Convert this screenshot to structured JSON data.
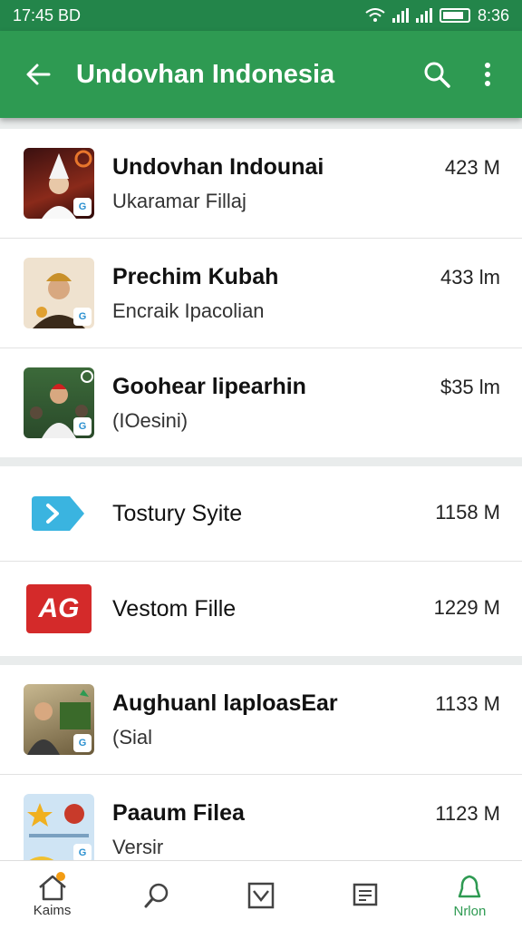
{
  "status_bar": {
    "time_left": "17:45 BD",
    "time_right": "8:36"
  },
  "app_bar": {
    "title": "Undovhan Indonesia"
  },
  "groups": [
    [
      {
        "name": "Undovhan Indounai",
        "subtitle": "Ukaramar Fillaj",
        "size": "423 M"
      },
      {
        "name": "Prechim Kubah",
        "subtitle": "Encraik Ipacolian",
        "size": "433 lm"
      },
      {
        "name": "Goohear lipearhin",
        "subtitle": "(IOesini)",
        "size": "$35 lm"
      }
    ],
    [
      {
        "name": "Tostury Syite",
        "size": "1158 M"
      },
      {
        "name": "Vestom Fille",
        "size": "1229 M",
        "icon_text": "AG"
      }
    ],
    [
      {
        "name": "Aughuanl laploasEar",
        "subtitle": "(Sial",
        "size": "1133 M"
      },
      {
        "name": "Paaum Filea",
        "subtitle": "Versir",
        "size": "1123 M"
      }
    ]
  ],
  "bottom_nav": {
    "home_label": "Kaims",
    "active_label": "Nrlon"
  },
  "colors": {
    "app_bar": "#2e9a52",
    "status_bar": "#23854a",
    "active": "#2e9a52"
  }
}
